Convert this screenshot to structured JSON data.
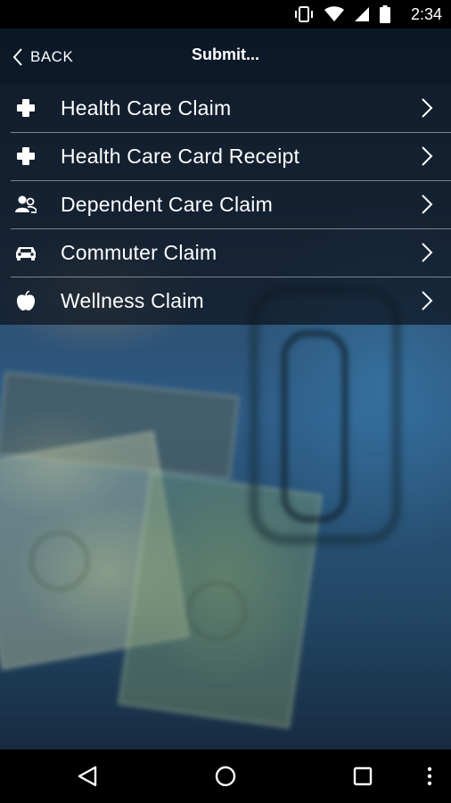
{
  "status_bar": {
    "time": "2:34",
    "icons": [
      "vibrate-icon",
      "wifi-icon",
      "signal-icon",
      "battery-icon"
    ]
  },
  "header": {
    "back_label": "BACK",
    "title": "Submit..."
  },
  "menu": {
    "items": [
      {
        "label": "Health Care Claim",
        "icon": "plus-icon"
      },
      {
        "label": "Health Care Card Receipt",
        "icon": "plus-icon"
      },
      {
        "label": "Dependent Care Claim",
        "icon": "people-icon"
      },
      {
        "label": "Commuter Claim",
        "icon": "car-icon"
      },
      {
        "label": "Wellness Claim",
        "icon": "apple-icon"
      }
    ]
  },
  "nav_bar": {
    "buttons": [
      "back-triangle-icon",
      "home-circle-icon",
      "recents-square-icon",
      "overflow-menu-icon"
    ]
  },
  "colors": {
    "header_bg": "#08141f",
    "text": "#ffffff",
    "divider": "#d2d7dc"
  }
}
